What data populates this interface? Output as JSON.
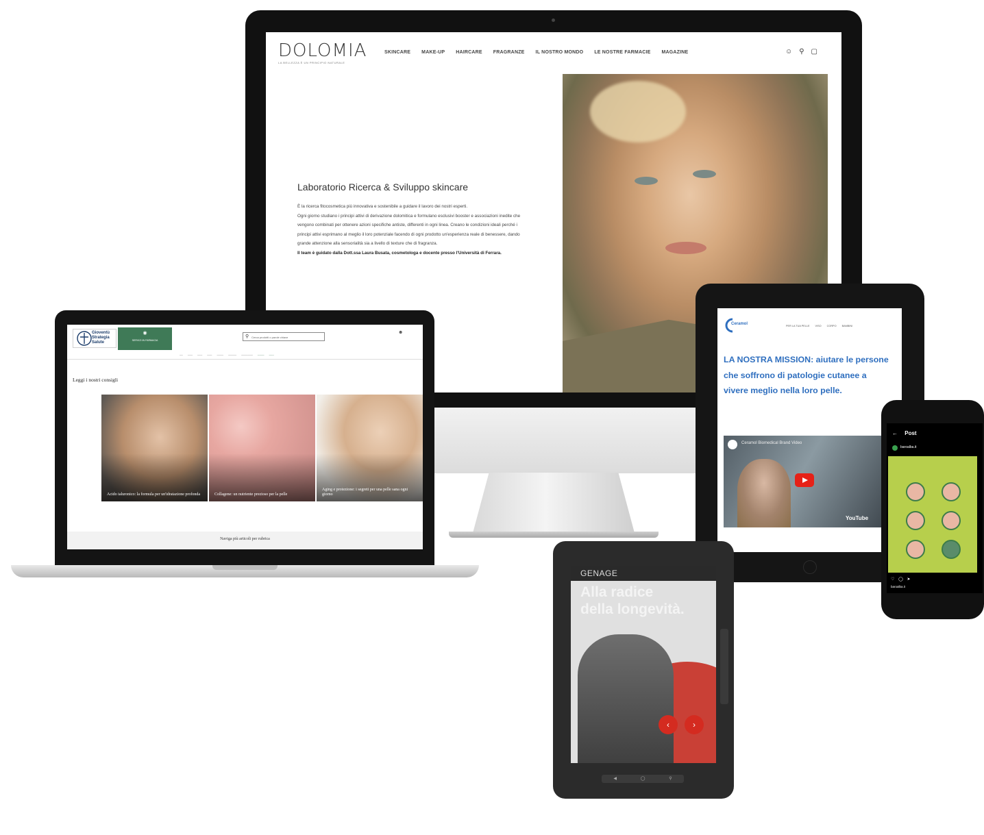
{
  "dolomia": {
    "logo": "DOLOMIA",
    "tagline": "LA BELLEZZA È UN PRINCIPIO NATURALE",
    "nav": [
      "SKINCARE",
      "MAKE-UP",
      "HAIRCARE",
      "FRAGRANZE",
      "IL NOSTRO MONDO",
      "LE NOSTRE FARMACIE",
      "MAGAZINE"
    ],
    "heading": "Laboratorio Ricerca & Sviluppo skincare",
    "paragraph1": "È la ricerca fitocosmetica più innovativa e sostenibile a guidare il lavoro dei nostri esperti.",
    "paragraph2": "Ogni giorno studiano i principi attivi di derivazione dolomitica e formulano esclusivi booster e associazioni inedite che vengono combinati per ottenere azioni specifiche antiste, differenti in ogni linea. Creano le condizioni ideali perché i principi attivi esprimano al meglio il loro potenziale facendo di ogni prodotto un'esperienza reale di benessere, dando grande attenzione alla sensorialità sia a livello di texture che di fragranza.",
    "paragraph3": "Il team è guidato dalla Dott.ssa Laura Busata, cosmetologa e docente presso l'Università di Ferrara."
  },
  "laptop_site": {
    "logo_text": "Gioventù Strategia Salute",
    "green_button": "SERVIZI IN FARMACIA",
    "search_placeholder": "Cerca prodotti o parole chiave",
    "section_title": "Leggi i nostri consigli",
    "cards": [
      {
        "caption": "Acido ialuronico: la formula per un'idratazione profonda"
      },
      {
        "caption": "Collagene: un nutriente prezioso per la pelle"
      },
      {
        "caption": "Aging e protezione: i segreti per una pelle sana ogni giorno"
      }
    ],
    "footer_link": "Naviga più articoli per rubrica"
  },
  "ceramol": {
    "logo": "Ceramol",
    "nav": [
      "PER LA TUA PELLE",
      "VISO",
      "CORPO",
      "BAMBINI"
    ],
    "mission": "LA NOSTRA MISSION: aiutare le persone che soffrono di patologie cutanee a vivere meglio nella loro pelle.",
    "video_title": "Ceramol Biomedical Brand Video",
    "video_logo": "YouTube"
  },
  "phone": {
    "header": "Post",
    "account": "baroalba.it",
    "footer": "baroalba.it"
  },
  "ereader": {
    "brand": "GENAGE",
    "headline_line1": "Alla radice",
    "headline_line2": "della longevità."
  },
  "colors": {
    "ceramol_blue": "#2f6fbf",
    "green_accent": "#3f7a57",
    "genage_red": "#d42b20",
    "phone_post": "#b7cf4c"
  }
}
